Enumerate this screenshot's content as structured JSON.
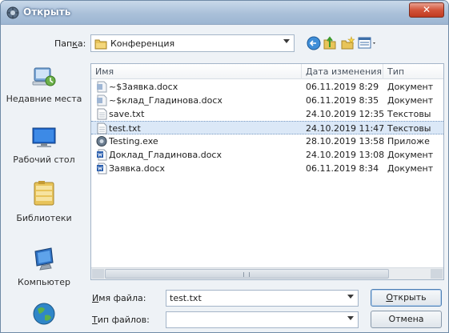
{
  "window": {
    "title": "Открыть",
    "close_label": "✕"
  },
  "places": [
    {
      "label": "Недавние места",
      "icon": "recent-places-icon"
    },
    {
      "label": "Рабочий стол",
      "icon": "desktop-icon"
    },
    {
      "label": "Библиотеки",
      "icon": "libraries-icon"
    },
    {
      "label": "Компьютер",
      "icon": "computer-icon"
    }
  ],
  "folder": {
    "label_pre": "Пап",
    "label_u": "к",
    "label_post": "а:",
    "value": "Конференция"
  },
  "list": {
    "headers": {
      "name": "Имя",
      "date": "Дата изменения",
      "type": "Тип"
    },
    "rows": [
      {
        "name": "~$3аявка.docx",
        "date": "06.11.2019 8:29",
        "type": "Документ",
        "icon": "word-temp-icon"
      },
      {
        "name": "~$клад_Гладинова.docx",
        "date": "06.11.2019 8:35",
        "type": "Документ",
        "icon": "word-temp-icon"
      },
      {
        "name": "save.txt",
        "date": "24.10.2019 12:35",
        "type": "Текстовы",
        "icon": "text-file-icon"
      },
      {
        "name": "test.txt",
        "date": "24.10.2019 11:47",
        "type": "Текстовы",
        "icon": "text-file-icon",
        "selected": true
      },
      {
        "name": "Testing.exe",
        "date": "28.10.2019 13:58",
        "type": "Приложе",
        "icon": "exe-file-icon"
      },
      {
        "name": "Доклад_Гладинова.docx",
        "date": "24.10.2019 13:08",
        "type": "Документ",
        "icon": "word-doc-icon"
      },
      {
        "name": "Заявка.docx",
        "date": "06.11.2019 8:34",
        "type": "Документ",
        "icon": "word-doc-icon"
      }
    ]
  },
  "filename": {
    "label_u": "И",
    "label_post": "мя файла:",
    "value": "test.txt"
  },
  "filetype": {
    "label_u": "Т",
    "label_post": "ип файлов:",
    "value": ""
  },
  "buttons": {
    "open_u": "О",
    "open_post": "ткрыть",
    "cancel": "Отмена"
  },
  "colors": {
    "selection": "#dbe8f7",
    "titlebar": "#aac0d9",
    "close": "#d2543a"
  }
}
